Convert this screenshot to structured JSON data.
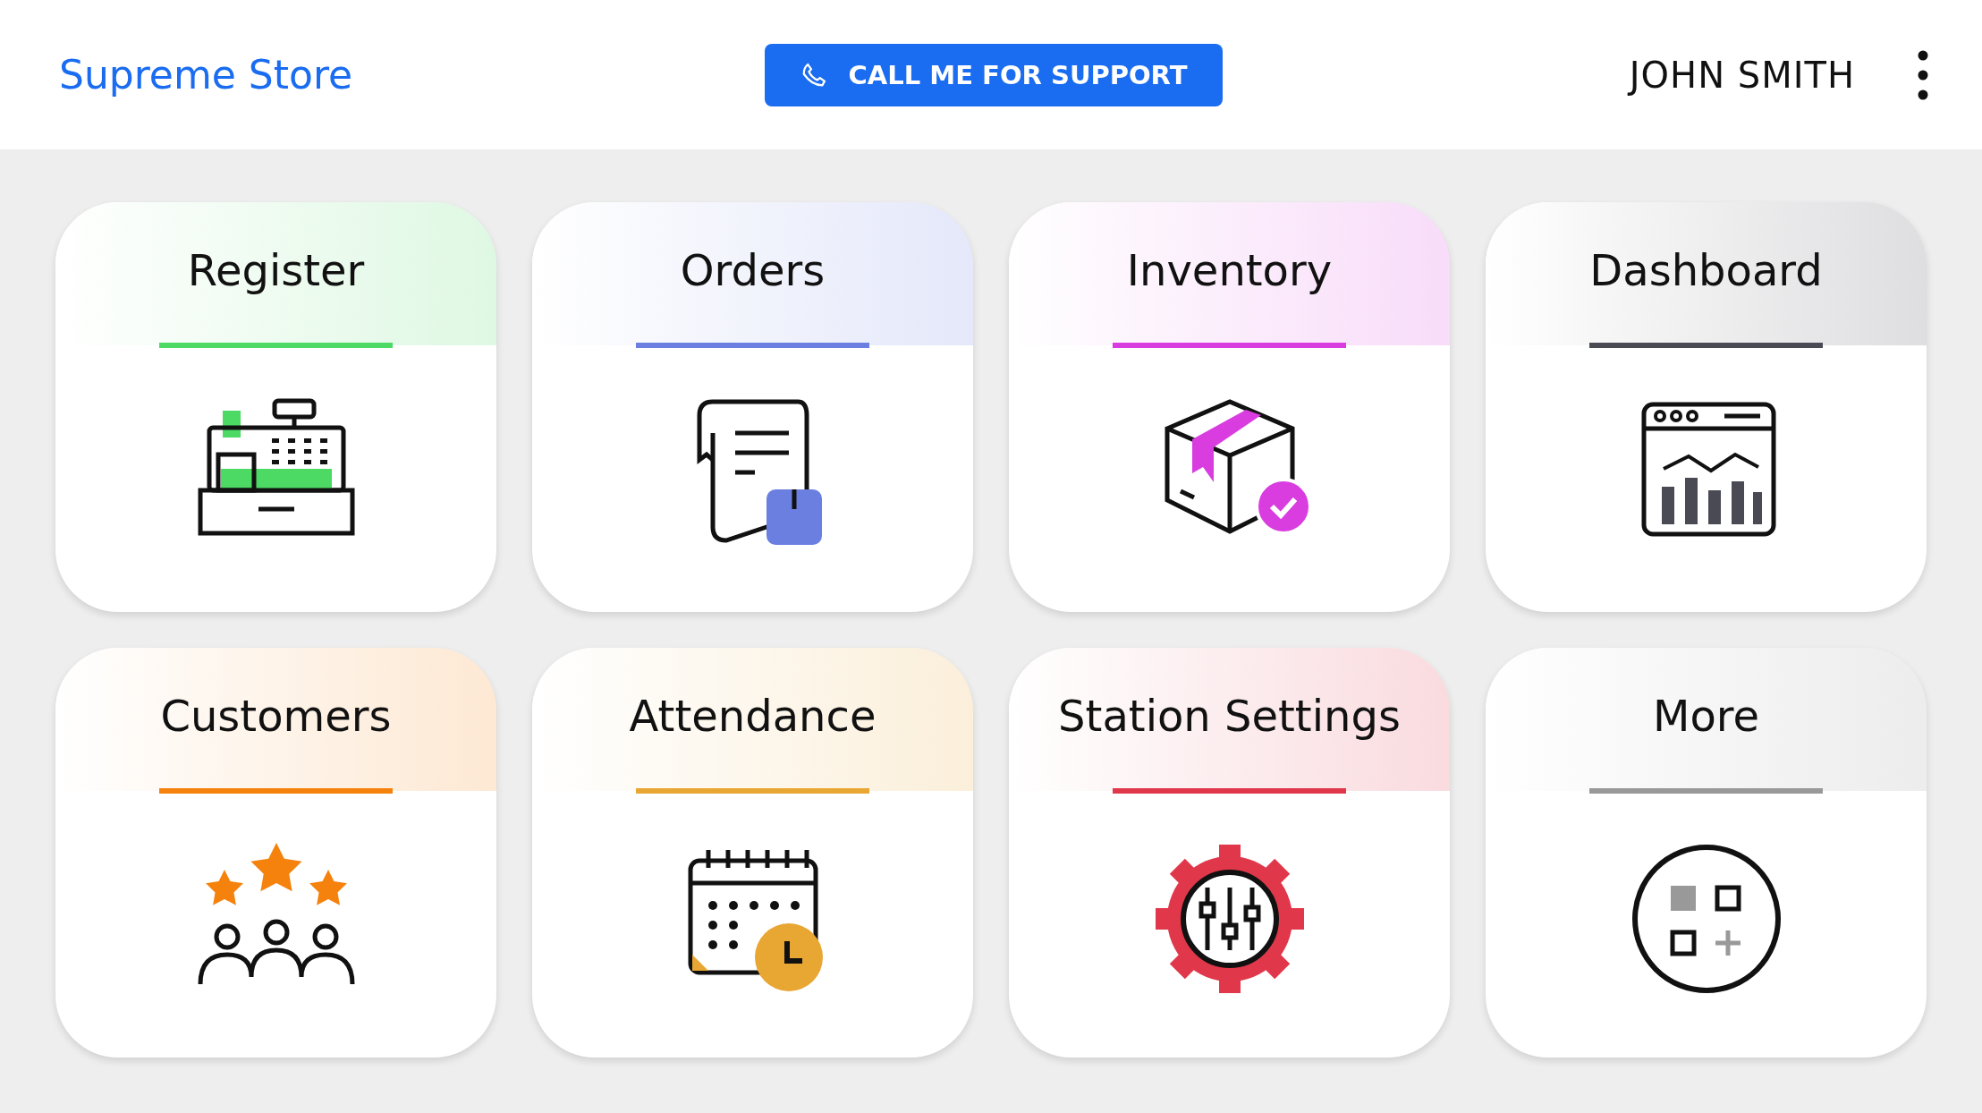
{
  "header": {
    "store_name": "Supreme Store",
    "support_button": "CALL ME FOR SUPPORT",
    "user_name": "JOHN SMITH"
  },
  "tiles": [
    {
      "title": "Register",
      "color": "#4cd964",
      "kind": "register"
    },
    {
      "title": "Orders",
      "color": "#6b7fe0",
      "kind": "orders"
    },
    {
      "title": "Inventory",
      "color": "#d93de0",
      "kind": "inventory"
    },
    {
      "title": "Dashboard",
      "color": "#4a4a55",
      "kind": "dashboard"
    },
    {
      "title": "Customers",
      "color": "#f5820d",
      "kind": "customers"
    },
    {
      "title": "Attendance",
      "color": "#e8a633",
      "kind": "attendance"
    },
    {
      "title": "Station Settings",
      "color": "#e0384a",
      "kind": "settings"
    },
    {
      "title": "More",
      "color": "#999999",
      "kind": "more"
    }
  ]
}
